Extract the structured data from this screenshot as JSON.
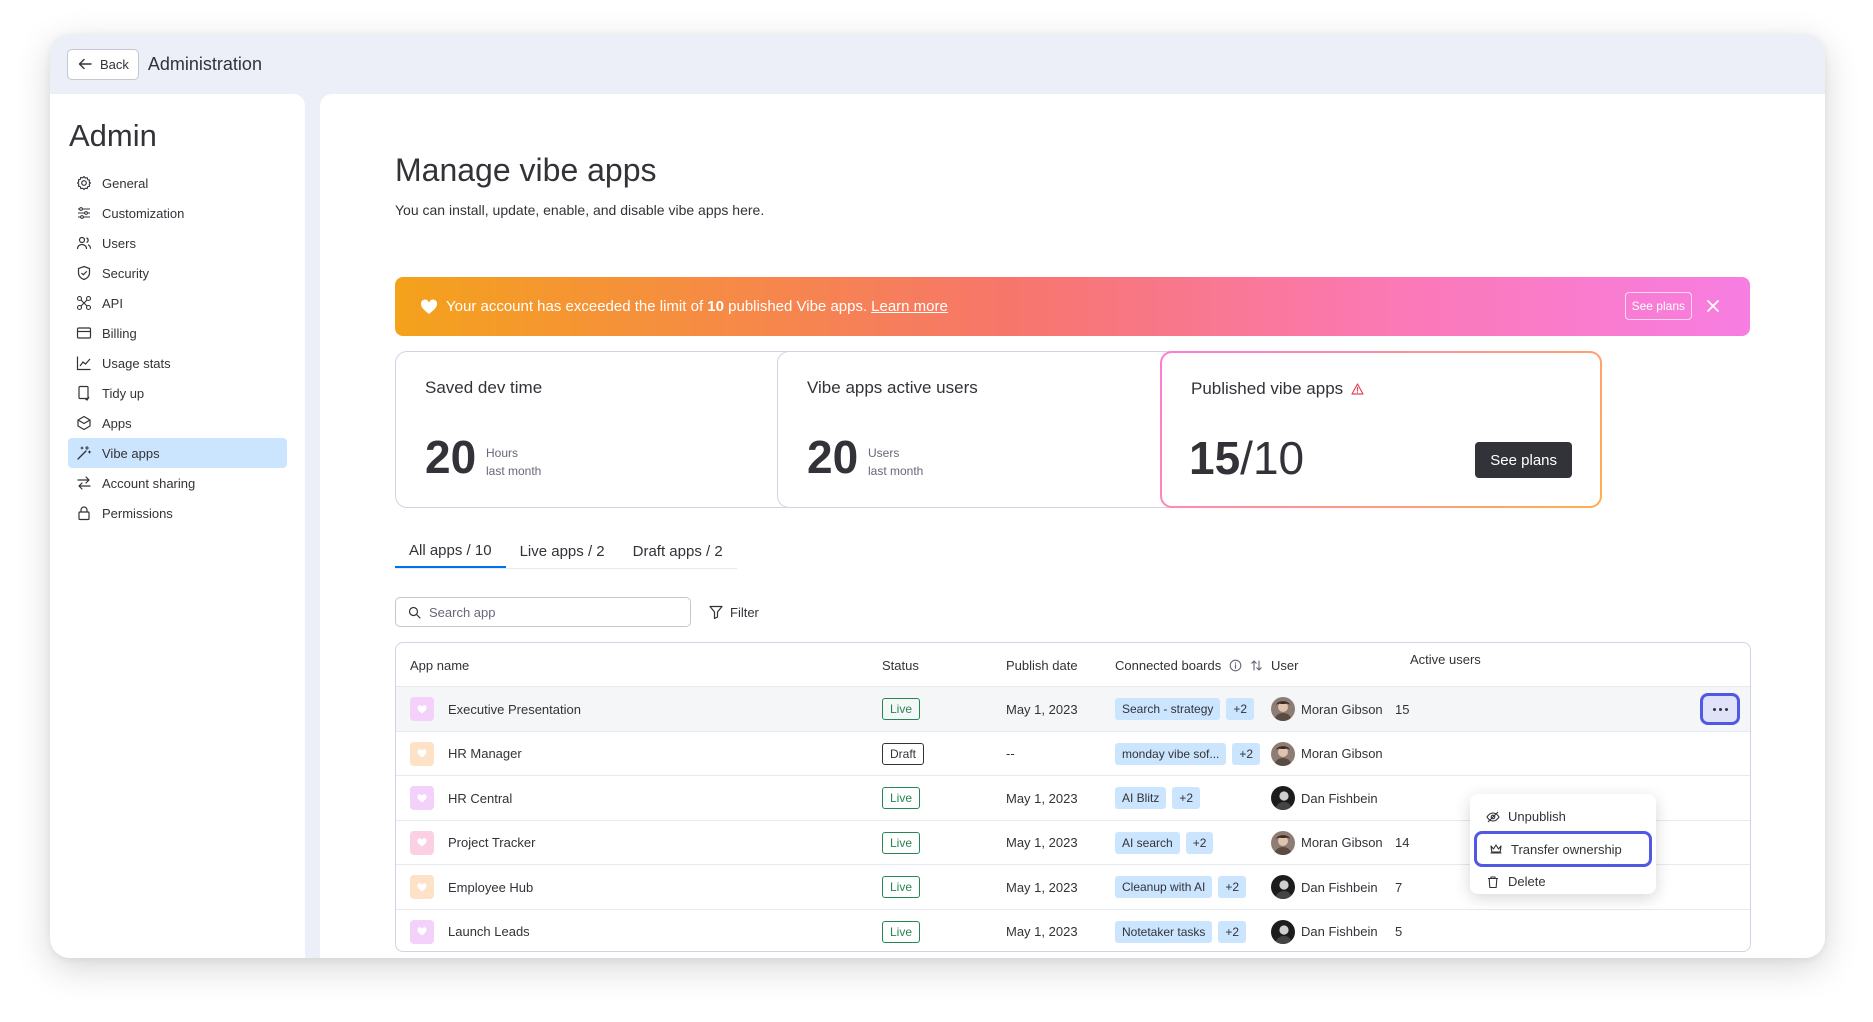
{
  "topbar": {
    "back_label": "Back",
    "title": "Administration"
  },
  "sidebar": {
    "title": "Admin",
    "items": [
      {
        "label": "General",
        "icon": "gear-icon"
      },
      {
        "label": "Customization",
        "icon": "sliders-icon"
      },
      {
        "label": "Users",
        "icon": "users-icon"
      },
      {
        "label": "Security",
        "icon": "shield-icon"
      },
      {
        "label": "API",
        "icon": "api-icon"
      },
      {
        "label": "Billing",
        "icon": "card-icon"
      },
      {
        "label": "Usage stats",
        "icon": "chart-icon"
      },
      {
        "label": "Tidy up",
        "icon": "broom-icon"
      },
      {
        "label": "Apps",
        "icon": "puzzle-icon"
      },
      {
        "label": "Vibe apps",
        "icon": "wand-icon"
      },
      {
        "label": "Account sharing",
        "icon": "arrows-icon"
      },
      {
        "label": "Permissions",
        "icon": "lock-icon"
      }
    ]
  },
  "page": {
    "title": "Manage vibe apps",
    "subtitle": "You can install, update, enable, and disable vibe apps here."
  },
  "banner": {
    "text_before": "Your account has exceeded the limit of",
    "limit": "10",
    "text_after": "published Vibe apps.",
    "link": "Learn more",
    "button": "See plans"
  },
  "cards": {
    "saved": {
      "title": "Saved dev time",
      "value": "20",
      "unit": "Hours",
      "period": "last month"
    },
    "active": {
      "title": "Vibe apps active users",
      "value": "20",
      "unit": "Users",
      "period": "last month"
    },
    "published": {
      "title": "Published vibe apps",
      "value": "15",
      "sep": "/",
      "limit": "10",
      "button": "See plans"
    }
  },
  "tabs": [
    "All apps / 10",
    "Live apps / 2",
    "Draft apps / 2"
  ],
  "search": {
    "placeholder": "Search app",
    "filter": "Filter"
  },
  "table": {
    "headers": {
      "name": "App name",
      "status": "Status",
      "date": "Publish date",
      "boards": "Connected boards",
      "user": "User",
      "active": "Active users"
    },
    "rows": [
      {
        "name": "Executive Presentation",
        "icon_color": "#f3d1fb",
        "status": "Live",
        "date": "May 1, 2023",
        "board": "Search - strategy",
        "more": "+2",
        "user": "Moran Gibson",
        "active": "15"
      },
      {
        "name": "HR Manager",
        "icon_color": "#fde2c8",
        "status": "Draft",
        "date": "--",
        "board": "monday vibe sof...",
        "more": "+2",
        "user": "Moran Gibson",
        "active": ""
      },
      {
        "name": "HR Central",
        "icon_color": "#f3d1fb",
        "status": "Live",
        "date": "May 1, 2023",
        "board": "AI Blitz",
        "more": "+2",
        "user": "Dan Fishbein",
        "active": ""
      },
      {
        "name": "Project Tracker",
        "icon_color": "#fbd0e3",
        "status": "Live",
        "date": "May 1, 2023",
        "board": "AI search",
        "more": "+2",
        "user": "Moran Gibson",
        "active": "14"
      },
      {
        "name": "Employee Hub",
        "icon_color": "#fde2c8",
        "status": "Live",
        "date": "May 1, 2023",
        "board": "Cleanup with AI",
        "more": "+2",
        "user": "Dan Fishbein",
        "active": "7"
      },
      {
        "name": "Launch Leads",
        "icon_color": "#f3d1fb",
        "status": "Live",
        "date": "May 1, 2023",
        "board": "Notetaker tasks",
        "more": "+2",
        "user": "Dan Fishbein",
        "active": "5"
      }
    ]
  },
  "menu": {
    "unpublish": "Unpublish",
    "transfer": "Transfer ownership",
    "delete": "Delete"
  }
}
